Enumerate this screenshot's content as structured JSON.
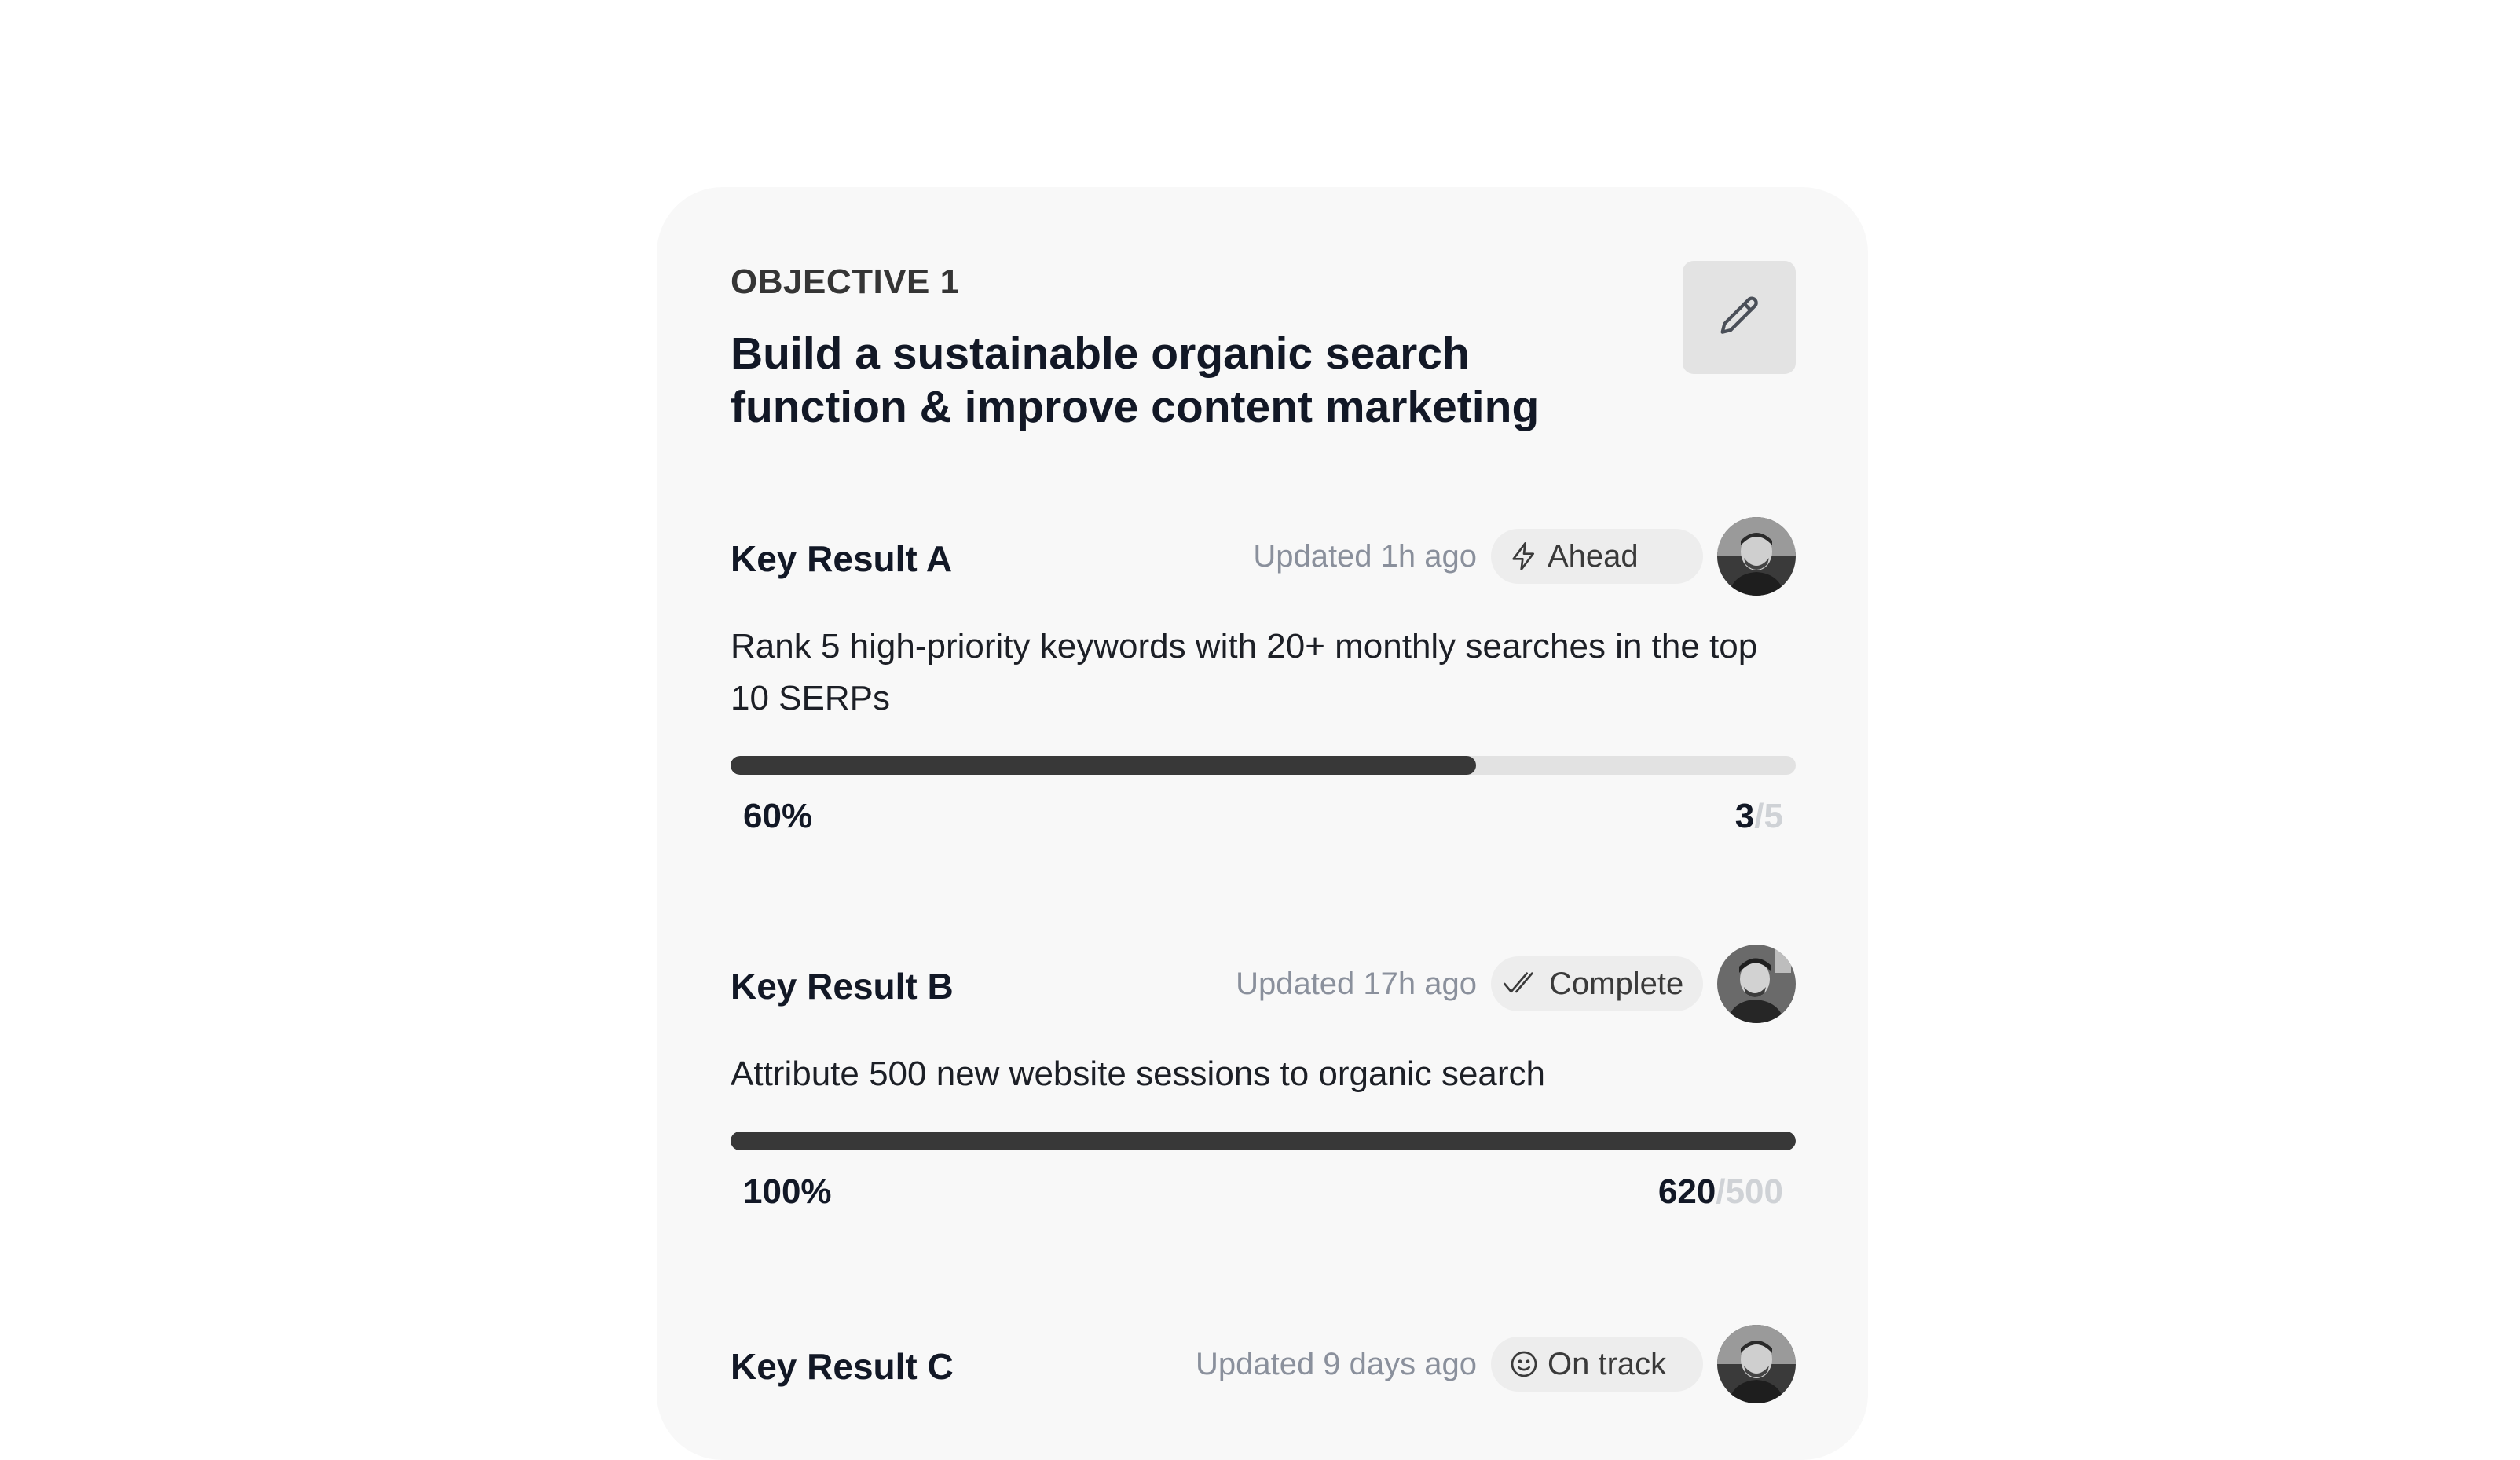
{
  "objective": {
    "label": "OBJECTIVE 1",
    "title": "Build a sustainable organic search function & improve content marketing",
    "edit_icon": "pencil-icon"
  },
  "key_results": [
    {
      "title": "Key Result A",
      "updated": "Updated 1h ago",
      "status": "Ahead",
      "status_icon": "lightning-icon",
      "description": "Rank 5 high-priority keywords with 20+ monthly searches in the top 10 SERPs",
      "percent": "60%",
      "progress_fraction": 0.7,
      "current": "3",
      "separator": "/",
      "target": "5"
    },
    {
      "title": "Key Result B",
      "updated": "Updated 17h ago",
      "status": "Complete",
      "status_icon": "double-check-icon",
      "description": "Attribute 500 new website sessions to organic search",
      "percent": "100%",
      "progress_fraction": 1.0,
      "current": "620",
      "separator": "/",
      "target": "500"
    },
    {
      "title": "Key Result C",
      "updated": "Updated 9 days ago",
      "status": "On track",
      "status_icon": "smiley-icon"
    }
  ],
  "colors": {
    "card_bg": "#f8f8f8",
    "progress_fill": "#383838",
    "progress_track": "#e2e2e2",
    "muted_text": "#8a909c"
  }
}
